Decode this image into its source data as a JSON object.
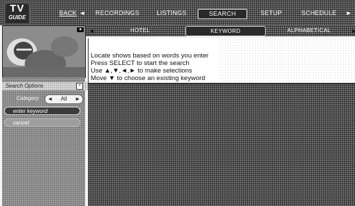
{
  "app": {
    "logo_line1": "TV",
    "logo_line2": "GUIDE"
  },
  "nav": {
    "items": [
      {
        "label": "Back"
      },
      {
        "label": "Recordings"
      },
      {
        "label": "Listings"
      },
      {
        "label": "Search"
      },
      {
        "label": "Setup"
      },
      {
        "label": "Schedule"
      }
    ],
    "selected": "Search"
  },
  "search_tabs": {
    "items": [
      {
        "label": "Hotel"
      },
      {
        "label": "Keyword"
      },
      {
        "label": "Alphabetical"
      }
    ],
    "selected": "Keyword"
  },
  "options": {
    "title": "Search Options",
    "category_label": "Category",
    "category_value": "All",
    "enter_keyword_label": "enter keyword",
    "cancel_label": "cancel"
  },
  "info": {
    "line1": "Locate shows based on words you enter",
    "line2": "Press SELECT to start the search",
    "line3_prefix": "Use ",
    "line3_arrows": "▲,▼,◄,►",
    "line3_suffix": " to make selections",
    "line4_prefix": "Move ",
    "line4_arrow": "▼",
    "line4_suffix": " to choose an existing keyword"
  },
  "preview": {
    "channel": "■"
  },
  "colors": {
    "header_bg": "#5a5a5a",
    "selected_tab": "#2a2a2a",
    "info_bg": "#ffffff"
  }
}
